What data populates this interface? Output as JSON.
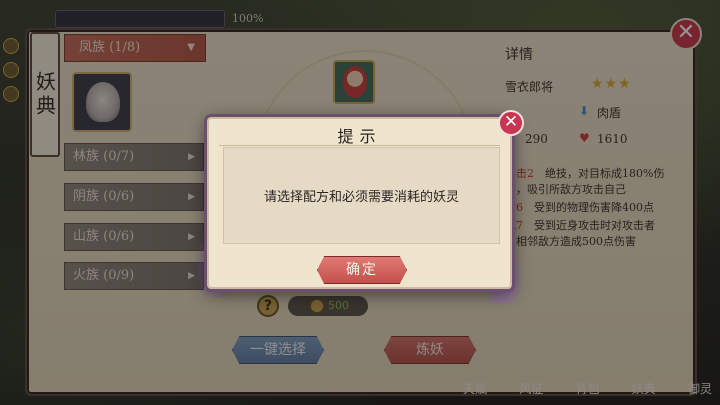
{
  "top": {
    "banner": "",
    "percent": "100%"
  },
  "panel": {
    "title": "妖典",
    "categories_selected": "凤族 (1/8)",
    "categories": [
      "林族 (0/7)",
      "阴族 (0/6)",
      "山族 (0/6)",
      "火族 (0/9)"
    ]
  },
  "center": {
    "help": "?",
    "cost": "500",
    "auto_select_label": "一键选择",
    "refine_label": "炼妖"
  },
  "details": {
    "header": "详情",
    "name": "雪衣郎将",
    "stars": "★★★",
    "type": "肉盾",
    "attack": "290",
    "hp": "1610",
    "skills": [
      {
        "key": "斜击2",
        "text": "绝技，对目标成180%伤害，吸引所敌方攻击自己"
      },
      {
        "key": "指6",
        "text": "受到的物理伤害降400点"
      },
      {
        "key": "戚7",
        "text": "受到近身攻击时对攻击者及相邻敌方造成500点伤害"
      }
    ]
  },
  "bottom_tabs": [
    "天赋",
    "风征",
    "背包",
    "妖典",
    "御灵"
  ],
  "dialog": {
    "title": "提示",
    "message": "请选择配方和必须需要消耗的妖灵",
    "confirm_label": "确定",
    "close_glyph": "✕"
  },
  "colors": {
    "accent_red": "#c4504b",
    "panel_bg": "#ece2cb",
    "border_brown": "#5c4a3e",
    "modal_border_purple": "#6b4f6e",
    "star_gold": "#d9a830",
    "blue_button": "#5d7da6"
  },
  "icons": {
    "main_close": "close-icon",
    "modal_close": "close-icon",
    "shield": "shield-icon",
    "heart": "heart-icon",
    "coin": "coin-icon",
    "dropdown": "chevron-down-icon",
    "category_arrow": "chevron-right-icon"
  }
}
